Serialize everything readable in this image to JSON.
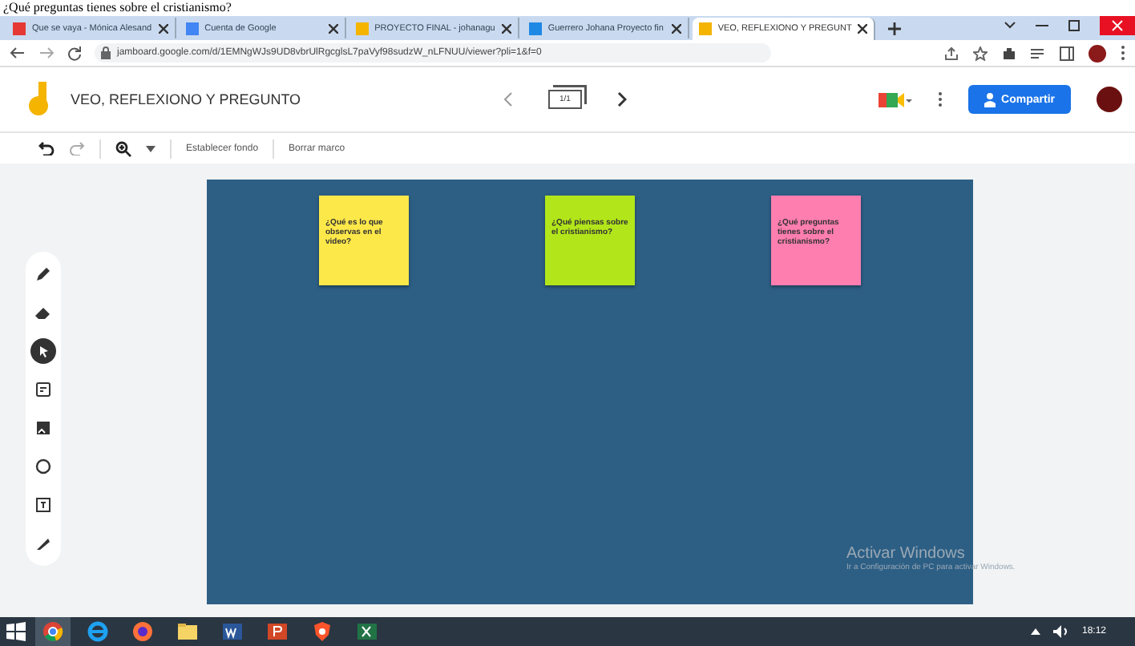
{
  "heading": "¿Qué preguntas tienes sobre el cristianismo?",
  "tabs": [
    {
      "label": "Que se vaya - Mónica Alesand",
      "selected": false,
      "color": "#e53935"
    },
    {
      "label": "Cuenta de Google",
      "selected": false,
      "color": "#4285f4"
    },
    {
      "label": "PROYECTO FINAL - johanagu",
      "selected": false,
      "color": "#f4b400"
    },
    {
      "label": "Guerrero Johana Proyecto fin",
      "selected": false,
      "color": "#1e88e5"
    },
    {
      "label": "VEO, REFLEXIONO Y PREGUNT",
      "selected": true,
      "color": "#f4b400"
    }
  ],
  "address": "jamboard.google.com/d/1EMNgWJs9UD8vbrUlRgcglsL7paVyf98sudzW_nLFNUU/viewer?pli=1&f=0",
  "jam": {
    "title": "VEO, REFLEXIONO Y PREGUNTO",
    "frame_counter": "1/1",
    "share": "Compartir"
  },
  "toolbar": [
    "Establecer fondo",
    "Borrar marco"
  ],
  "tools": [
    {
      "kind": "pen",
      "selected": false
    },
    {
      "kind": "eraser",
      "selected": false
    },
    {
      "kind": "select",
      "selected": true
    },
    {
      "kind": "note",
      "selected": false
    },
    {
      "kind": "image",
      "selected": false
    },
    {
      "kind": "circle",
      "selected": false
    },
    {
      "kind": "textbox",
      "selected": false
    },
    {
      "kind": "laser",
      "selected": false
    }
  ],
  "notes": [
    {
      "text": "¿Qué es lo que observas en el video?",
      "color": "#fde84a"
    },
    {
      "text": "¿Qué piensas sobre el cristianismo?",
      "color": "#b2e61a"
    },
    {
      "text": "¿Qué preguntas tienes sobre el cristianismo?",
      "color": "#ff7eb0"
    }
  ],
  "activation": {
    "title": "Activar Windows",
    "subtitle": "Ir a Configuración de PC para activar Windows."
  },
  "taskbar": {
    "apps": [
      {
        "kind": "chrome",
        "selected": true
      },
      {
        "kind": "ie",
        "selected": false
      },
      {
        "kind": "firefox",
        "selected": false
      },
      {
        "kind": "files",
        "selected": false
      },
      {
        "kind": "word",
        "selected": false
      },
      {
        "kind": "powerpoint",
        "selected": false
      },
      {
        "kind": "brave",
        "selected": false
      },
      {
        "kind": "excel",
        "selected": false
      }
    ],
    "time": "18:12"
  }
}
